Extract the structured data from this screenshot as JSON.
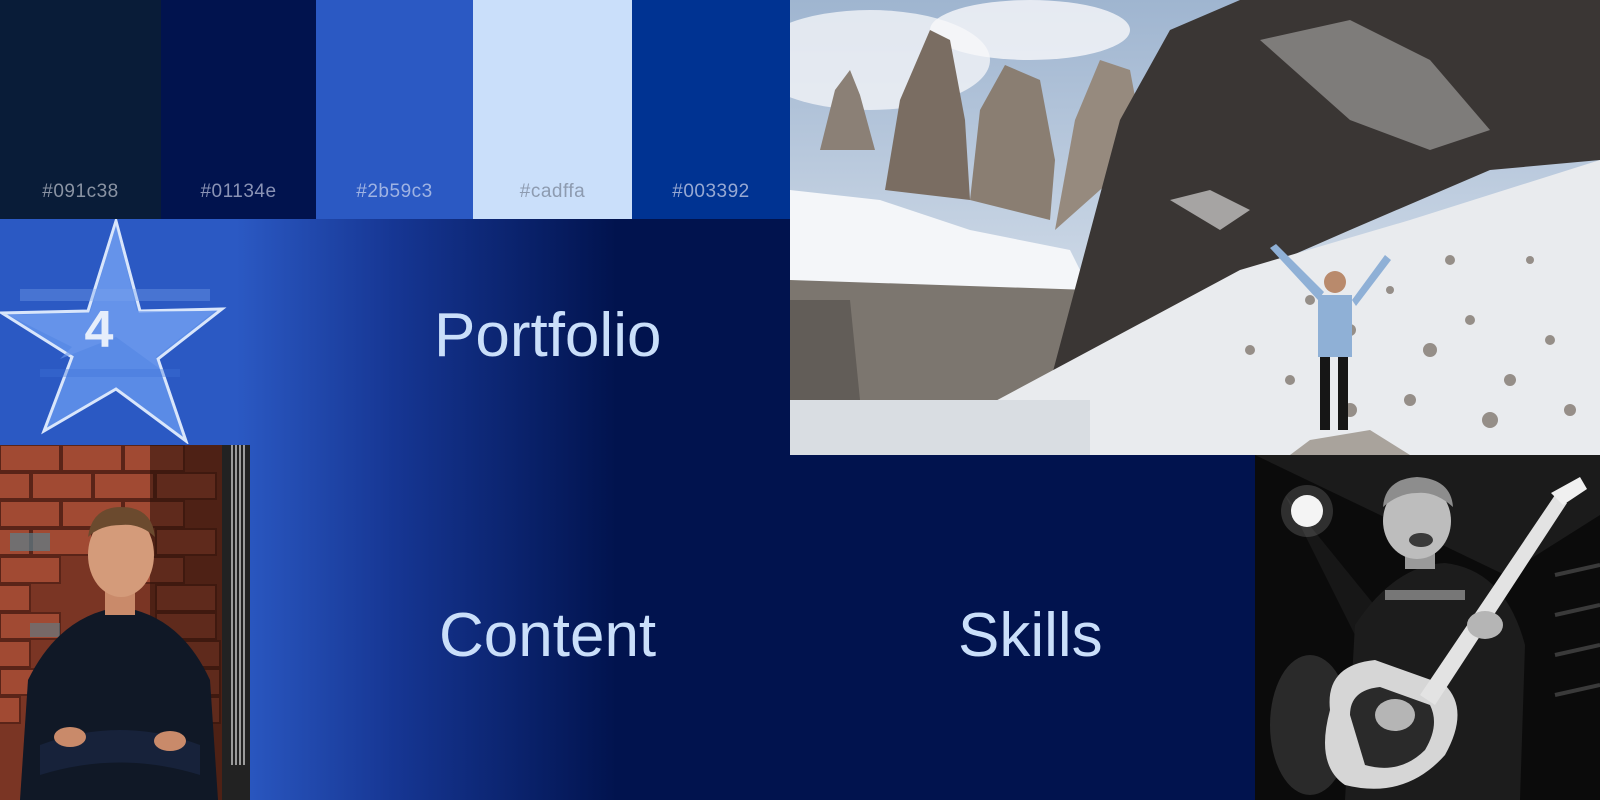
{
  "palette": {
    "swatches": [
      {
        "hex": "#091c38",
        "label": "#091c38"
      },
      {
        "hex": "#01134e",
        "label": "#01134e"
      },
      {
        "hex": "#2b59c3",
        "label": "#2b59c3"
      },
      {
        "hex": "#cadffa",
        "label": "#cadffa"
      },
      {
        "hex": "#003392",
        "label": "#003392"
      }
    ]
  },
  "badge": {
    "number": "4",
    "icon": "star-icon"
  },
  "sections": {
    "portfolio": "Portfolio",
    "content": "Content",
    "skills": "Skills"
  },
  "images": {
    "mountain": "mountain-photo",
    "portrait": "portrait-photo",
    "guitar": "guitar-photo"
  },
  "colors": {
    "text": "#cadffa",
    "accent": "#2b59c3",
    "background": "#01134e"
  }
}
